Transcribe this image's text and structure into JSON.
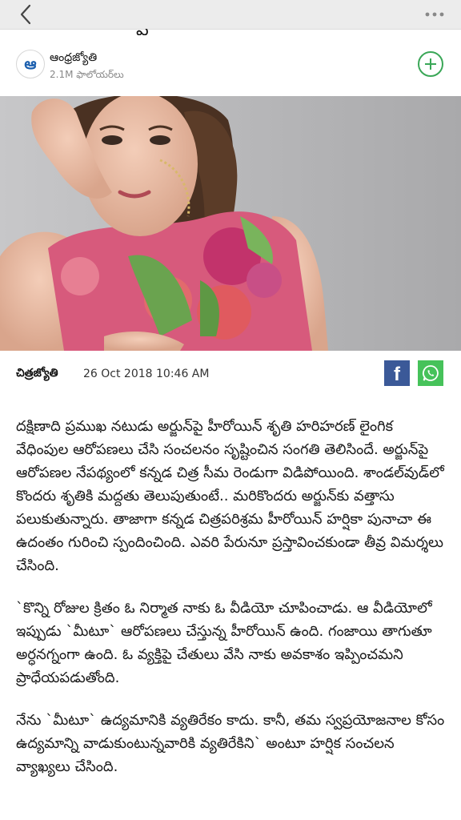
{
  "topbar": {
    "back_icon": "chevron-left-icon",
    "more_icon": "more-horizontal-icon"
  },
  "article": {
    "title_fragment": "పై"
  },
  "publisher": {
    "logo_text": "ఆ",
    "name": "ఆంధ్రజ్యోతి",
    "followers": "2.1M ఫాలోయర్‌లు",
    "follow_icon": "plus-icon",
    "accent": "#3aa757"
  },
  "meta": {
    "source": "చిత్రజ్యోతి",
    "date": "26 Oct 2018 10:46 AM",
    "facebook_letter": "f",
    "facebook_color": "#3b5998",
    "whatsapp_color": "#46c25a"
  },
  "paragraphs": [
    "దక్షిణాది ప్రముఖ నటుడు అర్జున్‌పై హీరోయిన్ శృతి హరిహరణ్ లైంగిక వేధింపుల ఆరోపణలు చేసి సంచలనం సృష్టించిన సంగతి తెలిసిందే. అర్జున్‌పై ఆరోపణల నేపథ్యంలో కన్నడ చిత్ర సీమ రెండుగా విడిపోయింది. శాండల్‌వుడ్‌లో కొందరు శృతికి మద్దతు తెలుపుతుంటే.. మరికొందరు అర్జున్‌కు వత్తాసు పలుకుతున్నారు. తాజాగా కన్నడ చిత్రపరిశ్రమ హీరోయిన్ హర్షికా పునాచా ఈ ఉదంతం గురించి స్పందించింది. ఎవరి పేరునూ ప్రస్తావించకుండా తీవ్ర విమర్శలు చేసింది.",
    "`కొన్ని రోజుల క్రితం ఓ నిర్మాత నాకు ఓ వీడియో చూపించాడు. ఆ వీడియోలో ఇప్పుడు `మీటూ` ఆరోపణలు చేస్తున్న హీరోయిన్ ఉంది. గంజాయి తాగుతూ అర్ధనగ్నంగా ఉంది. ఓ వ్యక్తిపై చేతులు వేసి నాకు అవకాశం ఇప్పించమని ప్రాధేయపడుతోంది.",
    "నేను `మీటూ` ఉద్యమానికి వ్యతిరేకం కాదు. కానీ, తమ స్వప్రయోజనాల కోసం ఉద్యమాన్ని వాడుకుంటున్నవారికి వ్యతిరేకిని` అంటూ హర్షిక సంచలన వ్యాఖ్యలు చేసింది."
  ]
}
